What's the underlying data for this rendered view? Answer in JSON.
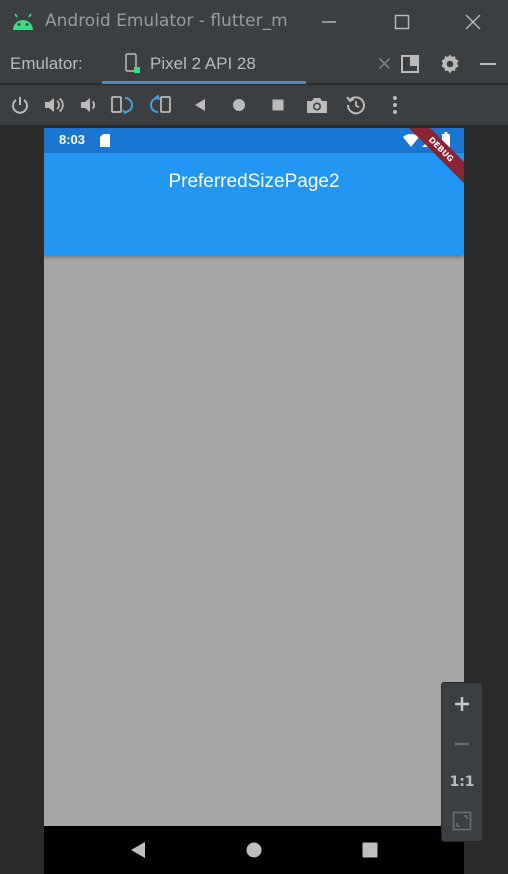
{
  "window": {
    "title": "Android Emulator - flutter_m"
  },
  "tabbar": {
    "label": "Emulator:",
    "tab_label": "Pixel 2 API 28"
  },
  "toolbar": {
    "buttons": [
      "power-icon",
      "volume-up-icon",
      "volume-down-icon",
      "rotate-left-icon",
      "rotate-right-icon",
      "back-icon",
      "home-icon",
      "overview-icon",
      "camera-icon",
      "snapshot-icon",
      "more-icon"
    ]
  },
  "device": {
    "status_time": "8:03",
    "app_title": "PreferredSizePage2",
    "debug_label": "DEBUG"
  },
  "zoom": {
    "plus": "+",
    "minus": "−",
    "one_to_one": "1:1"
  },
  "colors": {
    "status_bar": "#1976d2",
    "app_bar": "#2196f3",
    "body": "#a6a6a6",
    "chrome": "#3c3f41",
    "tab_underline": "#4a88c7",
    "android_green": "#3ddc84"
  }
}
